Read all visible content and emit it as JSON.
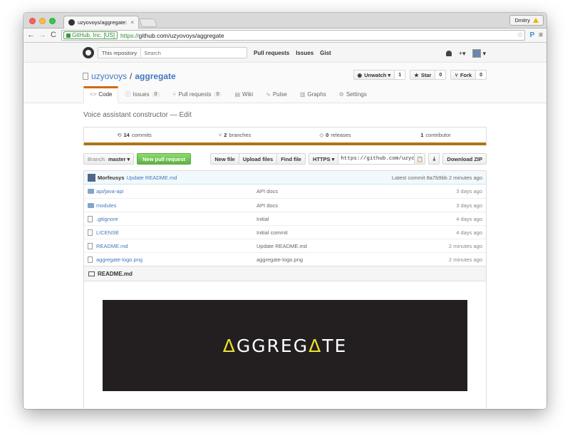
{
  "browser": {
    "tab_title": "uzyovoys/aggregate: Voice",
    "tab_close": "×",
    "profile_name": "Dmitry",
    "back_icon": "←",
    "forward_icon": "→",
    "reload_icon": "C",
    "ev_label": "GitHub, Inc. [US]",
    "url_scheme": "https://",
    "url_rest": "github.com/uzyovoys/aggregate",
    "bookmark_icon": "☆",
    "extension_label": "P",
    "menu_icon": "≡"
  },
  "gh": {
    "scope": "This repository",
    "search_placeholder": "Search",
    "nav": [
      "Pull requests",
      "Issues",
      "Gist"
    ],
    "plus": "+▾",
    "avatar_caret": "▾"
  },
  "repo": {
    "owner": "uzyovoys",
    "slash": "/",
    "name": "aggregate",
    "actions": {
      "unwatch": "Unwatch ▾",
      "unwatch_count": "1",
      "star": "Star",
      "star_count": "0",
      "fork": "Fork",
      "fork_count": "0"
    },
    "tabs": [
      {
        "icon": "<>",
        "label": "Code",
        "count": ""
      },
      {
        "icon": "ⓘ",
        "label": "Issues",
        "count": "0"
      },
      {
        "icon": "⑂",
        "label": "Pull requests",
        "count": "0"
      },
      {
        "icon": "▤",
        "label": "Wiki",
        "count": ""
      },
      {
        "icon": "∿",
        "label": "Pulse",
        "count": ""
      },
      {
        "icon": "▥",
        "label": "Graphs",
        "count": ""
      },
      {
        "icon": "⚙",
        "label": "Settings",
        "count": ""
      }
    ],
    "description": "Voice assistant constructor — Edit",
    "summary": {
      "commits_num": "14",
      "commits_label": "commits",
      "branches_num": "2",
      "branches_label": "branches",
      "releases_num": "0",
      "releases_label": "releases",
      "contributors_num": "1",
      "contributors_label": "contributor"
    },
    "filenav": {
      "branch_prefix": "Branch:",
      "branch_name": "master ▾",
      "new_pr": "New pull request",
      "new_file": "New file",
      "upload_files": "Upload files",
      "find_file": "Find file",
      "protocol": "HTTPS ▾",
      "clone_url": "https://github.com/uzyc",
      "clipboard_icon": "📋",
      "desktop_icon": "⤓",
      "download_zip": "Download ZIP"
    },
    "latest_commit": {
      "author": "Morfeusys",
      "message": "Update README.md",
      "meta": "Latest commit 8a7b9bb 2 minutes ago"
    },
    "files": [
      {
        "type": "dir",
        "name": "api/java-api",
        "message": "API docs",
        "age": "3 days ago"
      },
      {
        "type": "dir",
        "name": "modules",
        "message": "API docs",
        "age": "3 days ago"
      },
      {
        "type": "file",
        "name": ".gitignore",
        "message": "Initial",
        "age": "4 days ago"
      },
      {
        "type": "file",
        "name": "LICENSE",
        "message": "Initial commit",
        "age": "4 days ago"
      },
      {
        "type": "file",
        "name": "README.md",
        "message": "Update README.md",
        "age": "2 minutes ago"
      },
      {
        "type": "file",
        "name": "aggregate-logo.png",
        "message": "aggregate-logo.png",
        "age": "2 minutes ago"
      }
    ],
    "readme": {
      "title": "README.md",
      "logo_parts": [
        "Δ",
        "GGREG",
        "Δ",
        "TE"
      ],
      "logo_accent": "#e8e22a",
      "logo_bg": "#231f20"
    }
  },
  "colors": {
    "link": "#4078c0",
    "language_bar": "#b07219",
    "selected_tab_accent": "#d26911",
    "new_pr_green": "#60b044"
  }
}
